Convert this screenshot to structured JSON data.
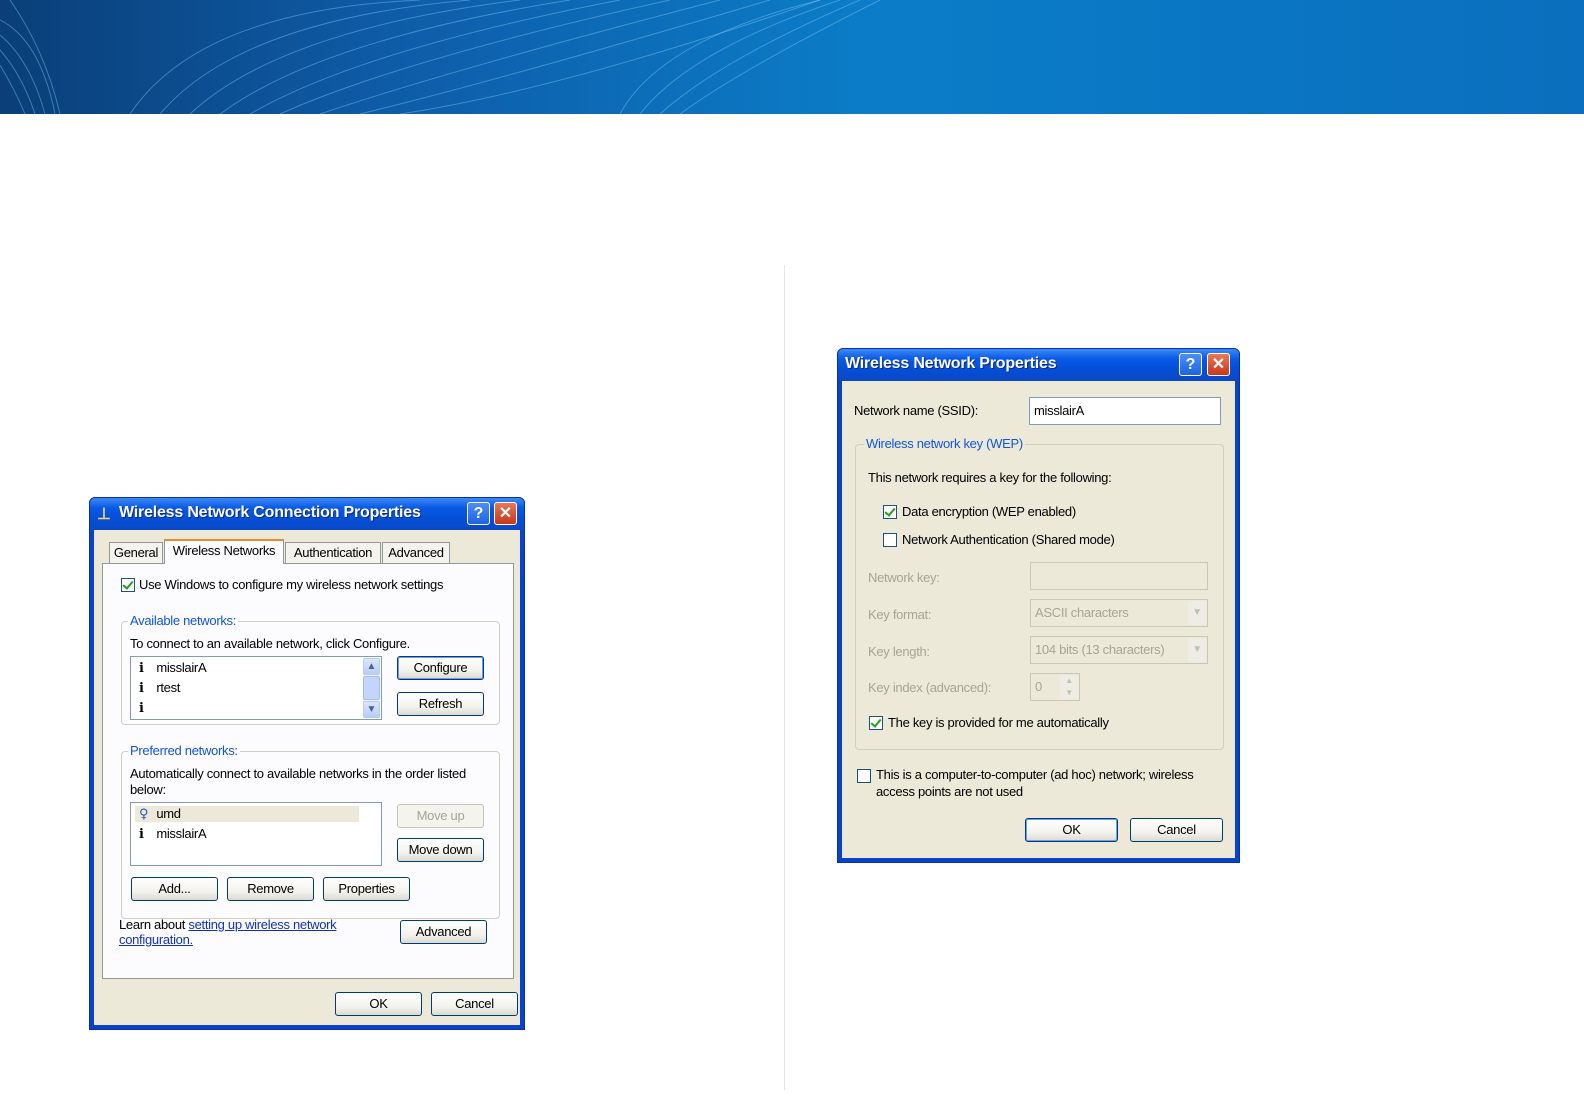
{
  "colors": {
    "banner": "#0b7dc8",
    "xp_title": "#0450d8",
    "xp_face": "#ece9d8"
  },
  "left_dialog": {
    "title": "Wireless Network Connection Properties",
    "title_icon": "network-connection-icon",
    "help_label": "?",
    "close_label": "✕",
    "tabs": [
      "General",
      "Wireless Networks",
      "Authentication",
      "Advanced"
    ],
    "active_tab": "Wireless Networks",
    "use_windows_label": "Use Windows to configure my wireless network settings",
    "available": {
      "legend": "Available networks:",
      "instruction": "To connect to an available network, click Configure.",
      "items": [
        {
          "icon": "network-info-icon",
          "name": "misslairA"
        },
        {
          "icon": "network-info-icon",
          "name": "rtest"
        },
        {
          "icon": "network-info-icon",
          "name": ""
        }
      ],
      "configure_label": "Configure",
      "refresh_label": "Refresh"
    },
    "preferred": {
      "legend": "Preferred networks:",
      "instruction_line1": "Automatically connect to available networks in the order listed",
      "instruction_line2": "below:",
      "items": [
        {
          "icon": "network-pin-icon",
          "name": "umd"
        },
        {
          "icon": "network-info-icon",
          "name": "misslairA"
        }
      ],
      "move_up_label": "Move up",
      "move_down_label": "Move down",
      "add_label": "Add...",
      "remove_label": "Remove",
      "properties_label": "Properties"
    },
    "learn_prefix": "Learn about",
    "learn_link_line1": "setting up wireless network",
    "learn_link_line2": "configuration.",
    "advanced_label": "Advanced",
    "ok_label": "OK",
    "cancel_label": "Cancel"
  },
  "right_dialog": {
    "title": "Wireless Network Properties",
    "help_label": "?",
    "close_label": "✕",
    "ssid_label": "Network name (SSID):",
    "ssid_value": "misslairA",
    "wep_legend": "Wireless network key (WEP)",
    "requires_text": "This network requires a key for the following:",
    "data_encryption_label": "Data encryption (WEP enabled)",
    "network_auth_label": "Network Authentication (Shared mode)",
    "network_key_label": "Network key:",
    "key_format_label": "Key format:",
    "key_format_value": "ASCII characters",
    "key_length_label": "Key length:",
    "key_length_value": "104 bits (13 characters)",
    "key_index_label": "Key index (advanced):",
    "key_index_value": "0",
    "auto_key_label": "The key is provided for me automatically",
    "adhoc_line1": "This is a computer-to-computer (ad hoc) network; wireless",
    "adhoc_line2": "access points are not used",
    "ok_label": "OK",
    "cancel_label": "Cancel"
  }
}
